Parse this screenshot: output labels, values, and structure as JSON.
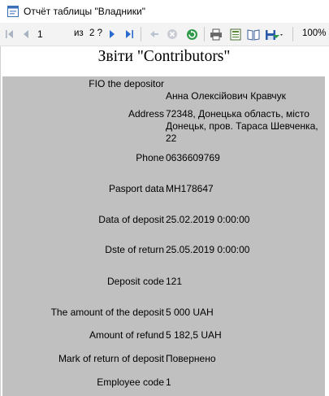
{
  "window": {
    "title": "Отчёт таблицы \"Владники\""
  },
  "toolbar": {
    "page_value": "1",
    "of_label": "из",
    "total_pages": "2 ?",
    "zoom": "100%"
  },
  "report": {
    "title": "Звіти \"Contributors\"",
    "fields": [
      {
        "label": "FIO the depositor",
        "value": "Анна Олексійович Кравчук"
      },
      {
        "label": "Address",
        "value": "72348, Донецька область, місто Донецьк, пров. Тараса Шевченка, 22"
      },
      {
        "label": "Phone",
        "value": "0636609769"
      },
      {
        "label": "Pasport data",
        "value": "МН178647"
      },
      {
        "label": "Data of deposit",
        "value": "25.02.2019 0:00:00"
      },
      {
        "label": "Dste of return",
        "value": "25.05.2019 0:00:00"
      },
      {
        "label": "Deposit code",
        "value": "121"
      },
      {
        "label": "The amount of the deposit",
        "value": "5 000 UAH"
      },
      {
        "label": "Amount of refund",
        "value": "5 182,5 UAH"
      },
      {
        "label": "Mark of return of deposit",
        "value": "Повернено"
      },
      {
        "label": "Employee code",
        "value": "1"
      }
    ]
  }
}
